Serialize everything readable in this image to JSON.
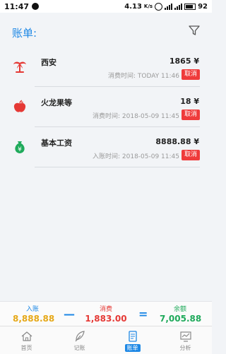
{
  "status_bar": {
    "time": "11:47",
    "network_speed": "4.13",
    "speed_unit": "K/s",
    "battery": "92"
  },
  "header": {
    "title": "账单:"
  },
  "bills": [
    {
      "name": "西安",
      "amount": "1865",
      "currency": "¥",
      "time_label": "消费时间:",
      "time": "TODAY 11:46",
      "cancel_label": "取消",
      "icon": "palm-tree-icon",
      "icon_color": "#e53935"
    },
    {
      "name": "火龙果等",
      "amount": "18",
      "currency": "¥",
      "time_label": "消费时间:",
      "time": "2018-05-09 11:45",
      "cancel_label": "取消",
      "icon": "apple-icon",
      "icon_color": "#e53935"
    },
    {
      "name": "基本工资",
      "amount": "8888.88",
      "currency": "¥",
      "time_label": "入账时间:",
      "time": "2018-05-09 11:45",
      "cancel_label": "取消",
      "icon": "money-bag-icon",
      "icon_color": "#1faa5b"
    }
  ],
  "summary": {
    "income_label": "入账",
    "income_value": "8,888.88",
    "income_color": "#e6a817",
    "minus": "—",
    "expense_label": "消费",
    "expense_value": "1,883.00",
    "expense_color": "#e53935",
    "equals": "=",
    "balance_label": "余额",
    "balance_value": "7,005.88",
    "balance_color": "#1faa5b"
  },
  "tabs": [
    {
      "label": "首页",
      "icon": "home-icon"
    },
    {
      "label": "记账",
      "icon": "feather-icon"
    },
    {
      "label": "账单",
      "icon": "bill-icon",
      "active": true
    },
    {
      "label": "分析",
      "icon": "chart-icon"
    }
  ]
}
